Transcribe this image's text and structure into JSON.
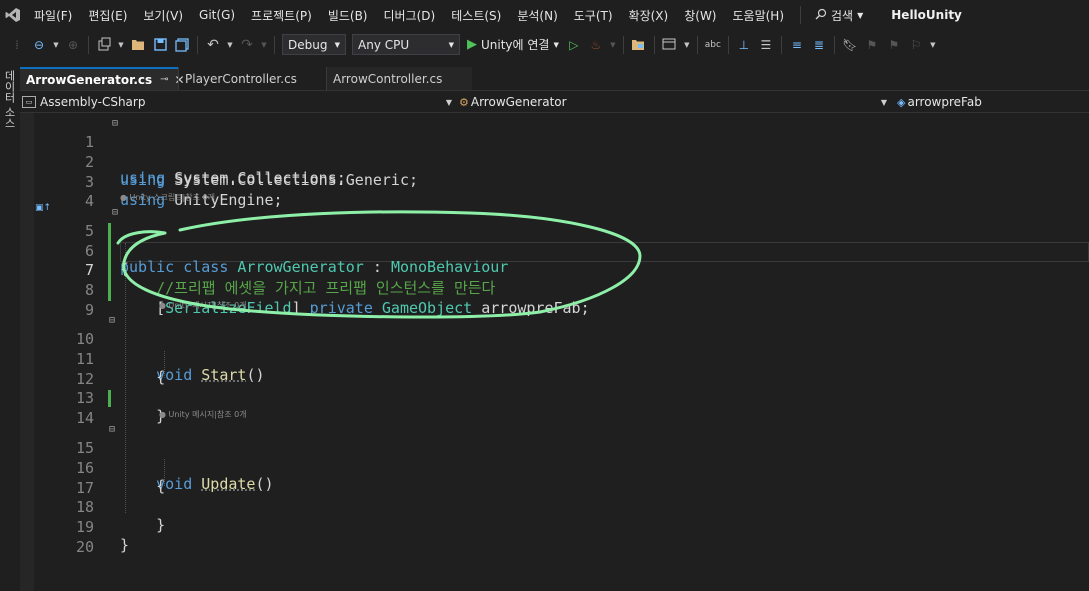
{
  "menu": {
    "items": [
      "파일(F)",
      "편집(E)",
      "보기(V)",
      "Git(G)",
      "프로젝트(P)",
      "빌드(B)",
      "디버그(D)",
      "테스트(S)",
      "분석(N)",
      "도구(T)",
      "확장(X)",
      "창(W)",
      "도움말(H)"
    ],
    "search_label": "검색",
    "project_name": "HelloUnity"
  },
  "toolbar": {
    "config": "Debug",
    "platform": "Any CPU",
    "run_label": "Unity에 연결"
  },
  "side_panel_label": "데이터 소스",
  "tabs": [
    {
      "label": "ArrowGenerator.cs",
      "active": true
    },
    {
      "label": "PlayerController.cs",
      "active": false
    },
    {
      "label": "ArrowController.cs",
      "active": false
    }
  ],
  "nav": {
    "project": "Assembly-CSharp",
    "class": "ArrowGenerator",
    "member": "arrowpreFab"
  },
  "code": {
    "line_numbers": [
      "1",
      "2",
      "3",
      "4",
      "5",
      "6",
      "7",
      "8",
      "9",
      "10",
      "11",
      "12",
      "13",
      "14",
      "15",
      "16",
      "17",
      "18",
      "19",
      "20"
    ],
    "current_line": "7",
    "kw_using": "using",
    "ns_collections": "System.Collections;",
    "ns_generic": "System.Collections.Generic;",
    "ns_unity": "UnityEngine;",
    "hint_class": "Unity 스크립트|참조 0개",
    "hint_start": "Unity 메시지|참조 0개",
    "hint_update": "Unity 메시지|참조 0개",
    "kw_public": "public",
    "kw_class": "class",
    "class_name": "ArrowGenerator",
    "colon": ":",
    "base_class": "MonoBehaviour",
    "open_brace": "{",
    "close_brace": "}",
    "comment": "//프리팹 에셋을 가지고 프리팹 인스턴스를 만든다",
    "attr_open": "[",
    "attribute": "SerializeField",
    "attr_close": "]",
    "kw_private": "private",
    "field_type": "GameObject",
    "field_name": "arrowpreFab",
    "semicolon": ";",
    "kw_void": "void",
    "method_start": "Start",
    "method_update": "Update",
    "parens": "()"
  },
  "colors": {
    "keyword": "#569cd6",
    "type": "#4ec9b0",
    "method": "#dcdcaa",
    "comment": "#57a64a",
    "annotation_scribble": "#8ef0a8",
    "change_bar": "#4caf50"
  },
  "icons": [
    "visual-studio-logo-icon",
    "back-icon",
    "forward-icon",
    "new-project-icon",
    "open-icon",
    "save-icon",
    "save-all-icon",
    "undo-icon",
    "redo-icon",
    "play-icon",
    "start-without-debug-icon",
    "hot-reload-icon",
    "search-icon",
    "bookmark-icon"
  ]
}
